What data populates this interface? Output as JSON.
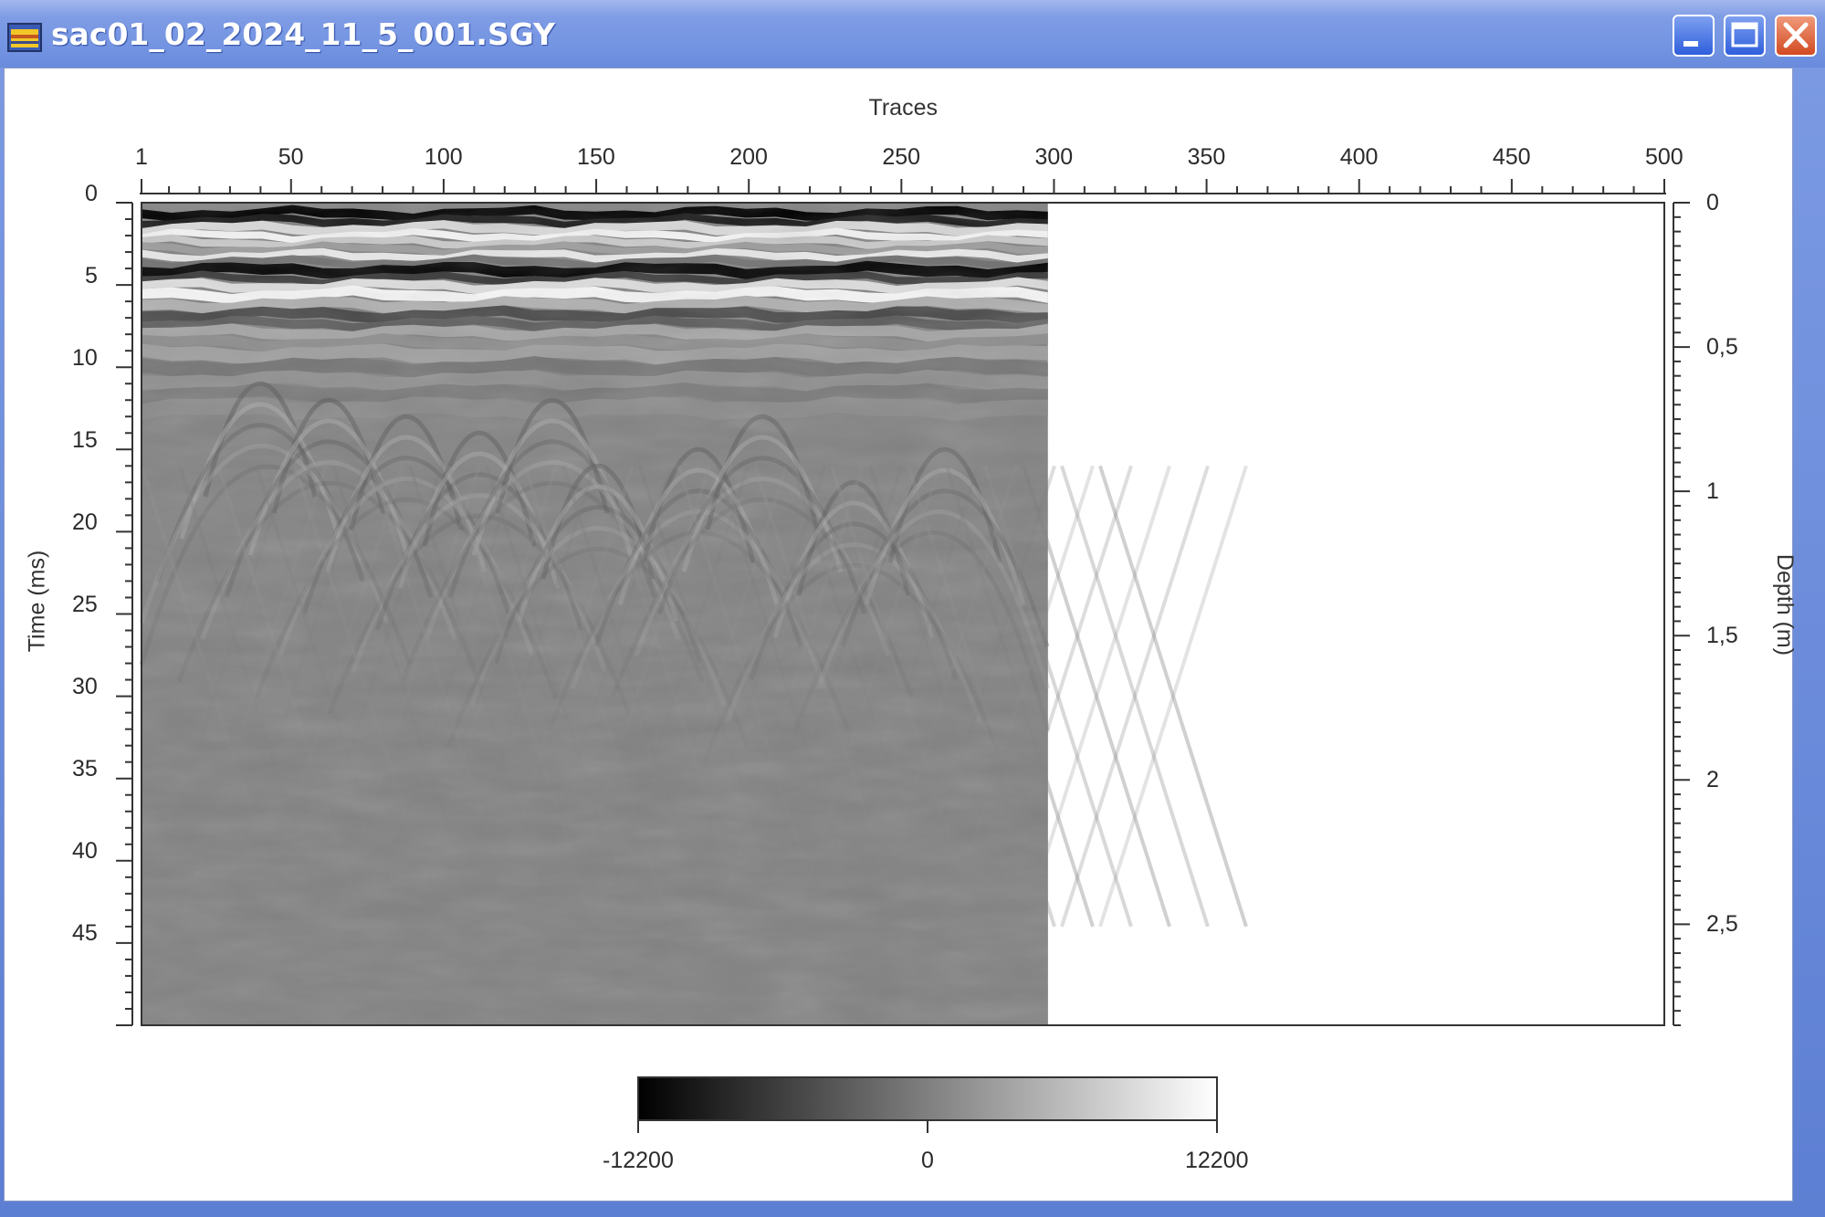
{
  "window": {
    "title": "sac01_02_2024_11_5_001.SGY"
  },
  "controls": {
    "minimize_icon": "minimize-icon",
    "maximize_icon": "maximize-icon",
    "close_icon": "close-icon"
  },
  "chart_data": {
    "type": "heatmap",
    "title": "",
    "xlabel": "Traces",
    "ylabel": "Time (ms)",
    "y2label": "Depth (m)",
    "x_ticks": [
      "1",
      "50",
      "100",
      "150",
      "200",
      "250",
      "300",
      "350",
      "400",
      "450",
      "500"
    ],
    "y_ticks": [
      "0",
      "5",
      "10",
      "15",
      "20",
      "25",
      "30",
      "35",
      "40",
      "45"
    ],
    "y2_ticks": [
      "0",
      "0,5",
      "1",
      "1,5",
      "2",
      "2,5"
    ],
    "x_range": [
      1,
      500
    ],
    "y_range": [
      0,
      50
    ],
    "y2_range": [
      0,
      2.85
    ],
    "data_extent_traces": [
      1,
      298
    ],
    "colormap": "grayscale",
    "colorbar": {
      "min_label": "-12200",
      "mid_label": "0",
      "max_label": "12200",
      "min": -12200,
      "max": 12200,
      "colors": [
        "#000000",
        "#ffffff"
      ]
    },
    "legend_placement": "bottom",
    "grid": false
  }
}
